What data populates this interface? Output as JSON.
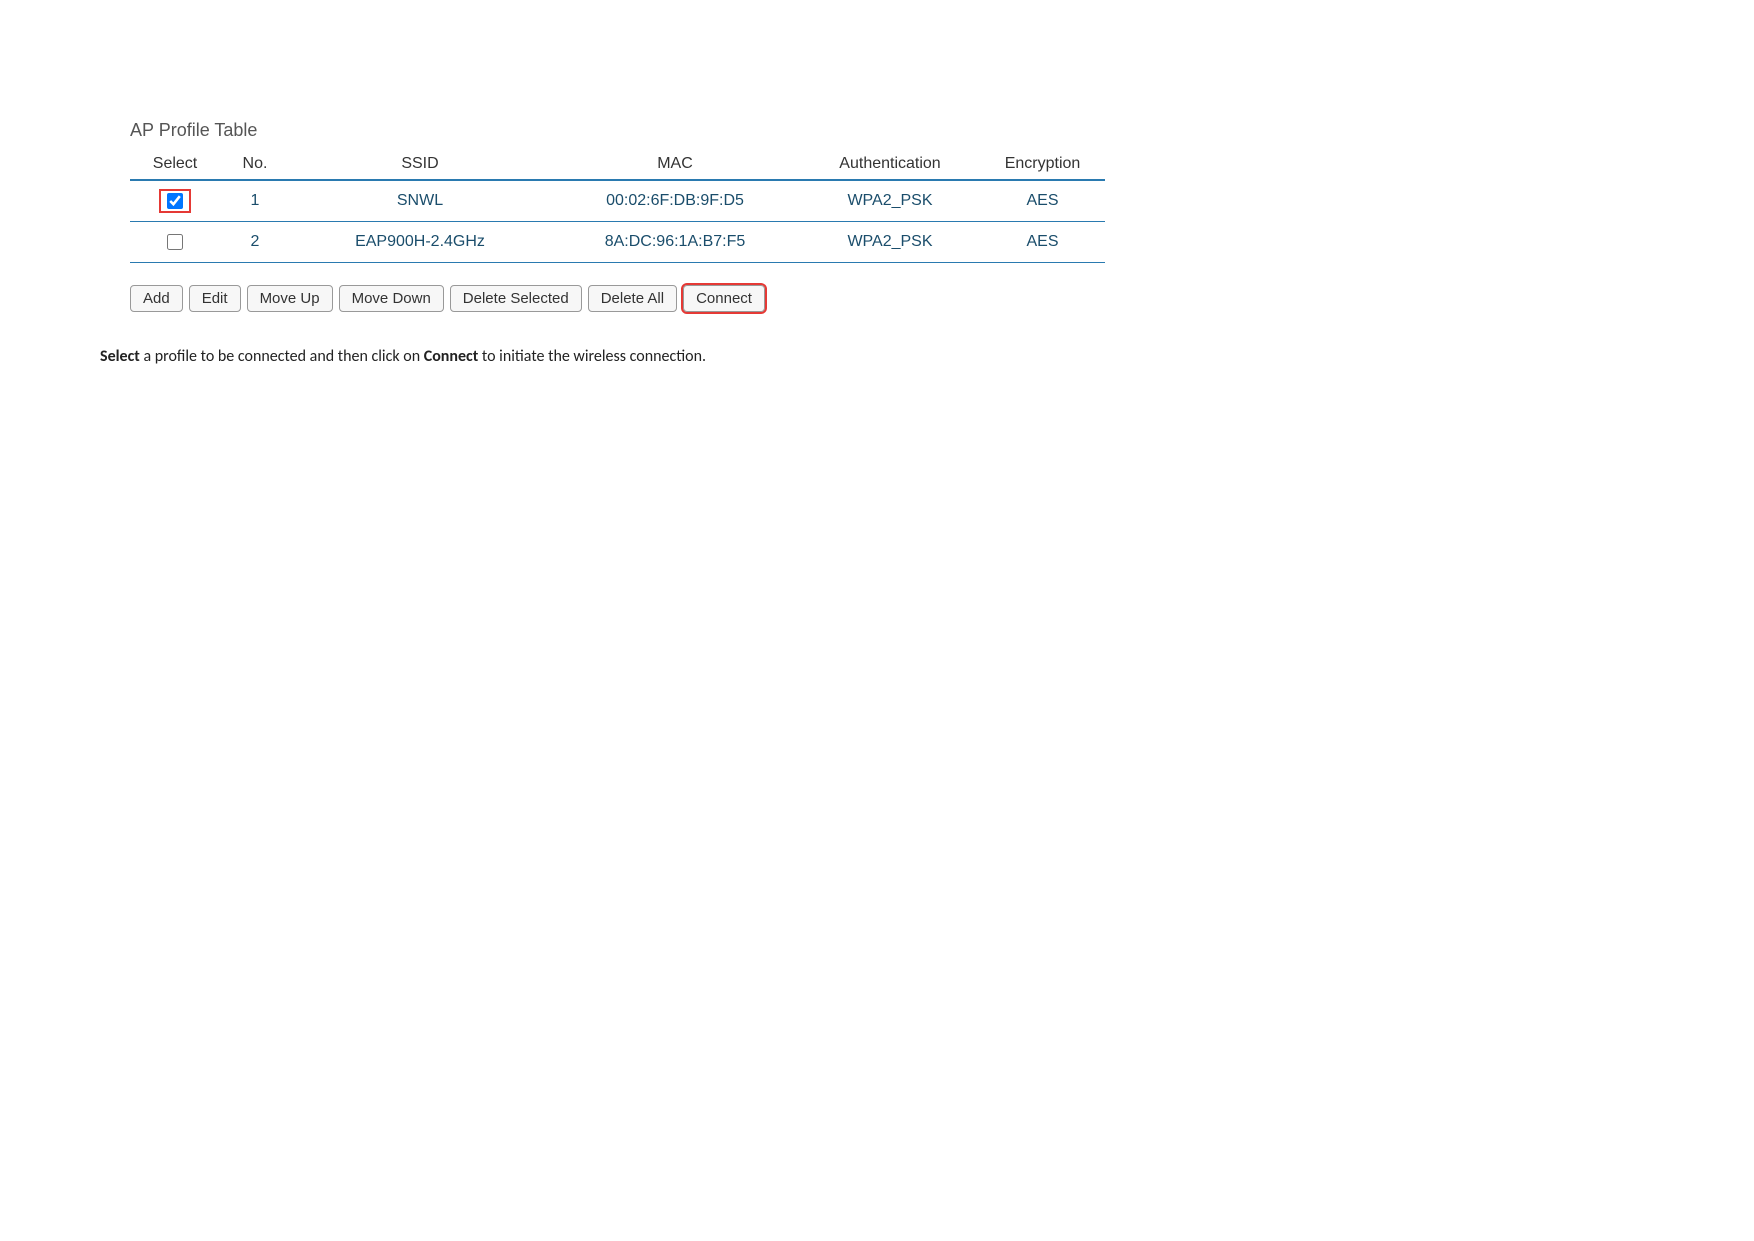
{
  "title": "AP Profile Table",
  "table": {
    "headers": {
      "select": "Select",
      "no": "No.",
      "ssid": "SSID",
      "mac": "MAC",
      "auth": "Authentication",
      "enc": "Encryption"
    },
    "rows": [
      {
        "no": "1",
        "ssid": "SNWL",
        "mac": "00:02:6F:DB:9F:D5",
        "auth": "WPA2_PSK",
        "enc": "AES",
        "checked": true,
        "highlighted": true
      },
      {
        "no": "2",
        "ssid": "EAP900H-2.4GHz",
        "mac": "8A:DC:96:1A:B7:F5",
        "auth": "WPA2_PSK",
        "enc": "AES",
        "checked": false,
        "highlighted": false
      }
    ]
  },
  "buttons": {
    "add": "Add",
    "edit": "Edit",
    "moveUp": "Move Up",
    "moveDown": "Move Down",
    "deleteSelected": "Delete Selected",
    "deleteAll": "Delete All",
    "connect": "Connect"
  },
  "instruction": {
    "part1": "Select",
    "part2": " a profile to be connected and then click on ",
    "part3": "Connect",
    "part4": " to initiate the wireless connection."
  }
}
